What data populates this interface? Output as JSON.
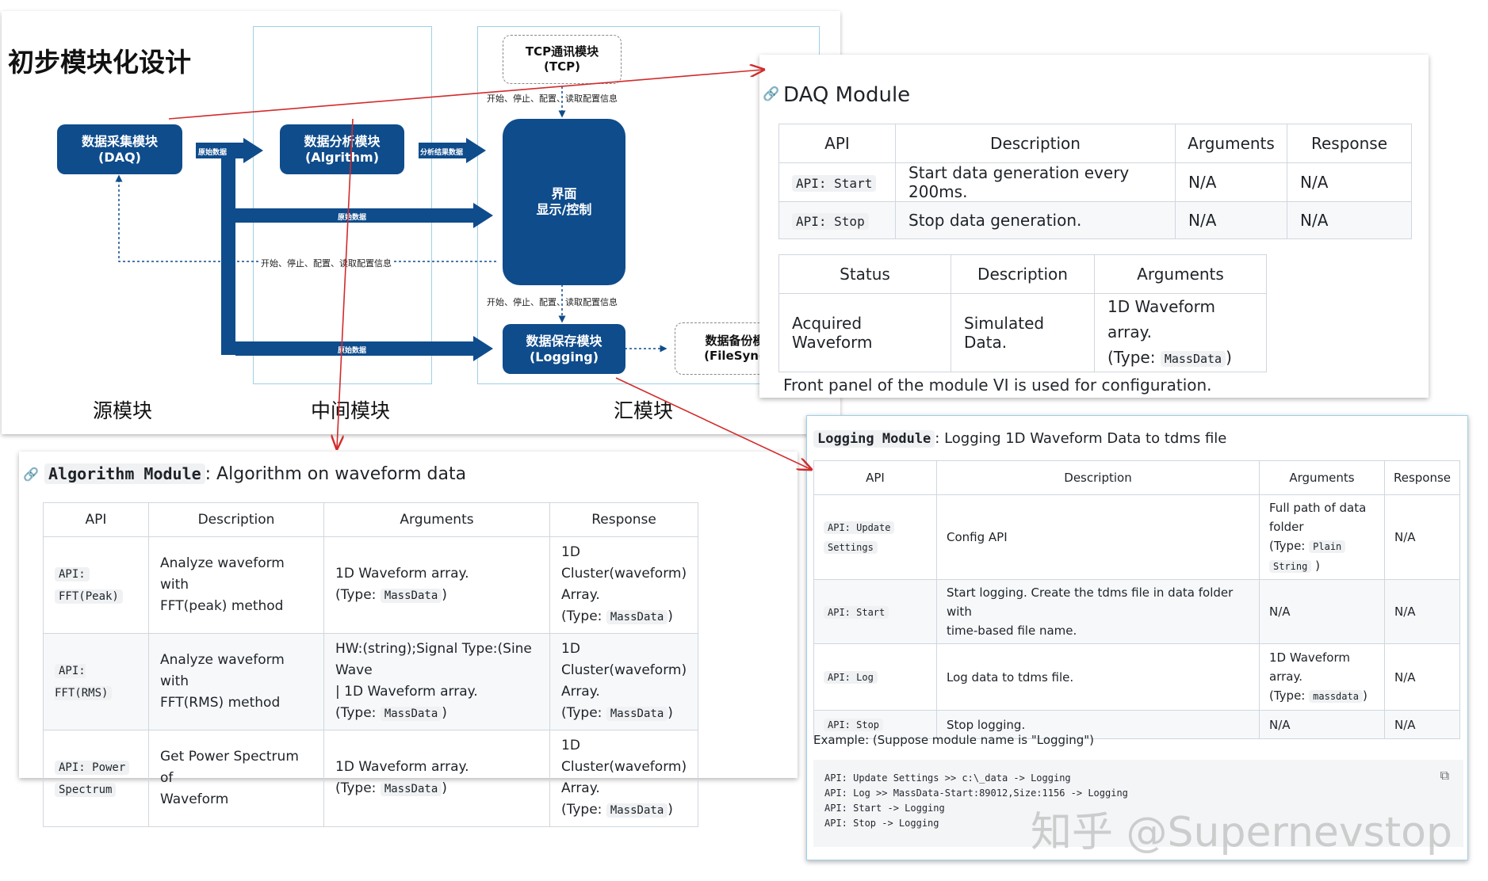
{
  "diagram": {
    "title": "初步模块化设计",
    "columns": {
      "source": "源模块",
      "middle": "中间模块",
      "sink": "汇模块"
    },
    "blocks": {
      "daq": [
        "数据采集模块",
        "(DAQ)"
      ],
      "algorithm": [
        "数据分析模块",
        "(Algrithm)"
      ],
      "ui": [
        "界面",
        "显示/控制"
      ],
      "logging": [
        "数据保存模块",
        "(Logging)"
      ],
      "tcp": [
        "TCP通讯模块",
        "(TCP)"
      ],
      "filesync": [
        "数据备份模",
        "(FileSync"
      ]
    },
    "labels": {
      "raw_data": "原始数据",
      "analysis_result": "分析结果数据",
      "control": "开始、停止、配置、读取配置信息"
    },
    "colors": {
      "block": "#0f4c8c",
      "link_arrow": "#d22b2b",
      "zone_border": "#9fd0e6"
    }
  },
  "daq_module": {
    "heading": "DAQ Module",
    "link_icon": "link-icon",
    "api_table": {
      "headers": [
        "API",
        "Description",
        "Arguments",
        "Response"
      ],
      "rows": [
        {
          "api": "API: Start",
          "description": "Start data generation every 200ms.",
          "arguments": "N/A",
          "response": "N/A"
        },
        {
          "api": "API: Stop",
          "description": "Stop data generation.",
          "arguments": "N/A",
          "response": "N/A"
        }
      ]
    },
    "status_table": {
      "headers": [
        "Status",
        "Description",
        "Arguments"
      ],
      "row": {
        "status": "Acquired Waveform",
        "description": "Simulated Data.",
        "arguments_line1": "1D Waveform array.",
        "arguments_type_prefix": "(Type:",
        "arguments_type": "MassData",
        "arguments_type_suffix": ")"
      }
    },
    "footer": "Front panel of the module VI is used for configuration."
  },
  "algorithm_module": {
    "heading_code": "Algorithm Module",
    "heading_text": ": Algorithm on waveform data",
    "headers": [
      "API",
      "Description",
      "Arguments",
      "Response"
    ],
    "rows": [
      {
        "api": [
          "API:",
          "FFT(Peak)"
        ],
        "description": [
          "Analyze waveform with",
          "FFT(peak) method"
        ],
        "arguments": [
          "1D Waveform array.",
          "(Type:",
          "MassData",
          ")"
        ],
        "response": [
          "1D Cluster(waveform)",
          "Array.",
          "(Type:",
          "MassData",
          ")"
        ]
      },
      {
        "api": [
          "API: FFT(RMS)"
        ],
        "description": [
          "Analyze waveform with",
          "FFT(RMS) method"
        ],
        "arguments": [
          "HW:(string);Signal Type:(Sine Wave",
          "| 1D Waveform array.",
          "(Type:",
          "MassData",
          ")"
        ],
        "response": [
          "1D Cluster(waveform)",
          "Array.",
          "(Type:",
          "MassData",
          ")"
        ]
      },
      {
        "api": [
          "API: Power",
          "Spectrum"
        ],
        "description": [
          "Get Power Spectrum of",
          "Waveform"
        ],
        "arguments": [
          "1D Waveform array.",
          "(Type:",
          "MassData",
          ")"
        ],
        "response": [
          "1D Cluster(waveform)",
          "Array.",
          "(Type:",
          "MassData",
          ")"
        ]
      }
    ]
  },
  "logging_module": {
    "heading_code": "Logging Module",
    "heading_text": ": Logging 1D Waveform Data to tdms file",
    "headers": [
      "API",
      "Description",
      "Arguments",
      "Response"
    ],
    "rows": [
      {
        "api": [
          "API: Update",
          "Settings"
        ],
        "description": [
          "Config API"
        ],
        "arguments": [
          "Full path of data",
          "folder",
          "(Type:",
          "Plain",
          "String",
          ")"
        ],
        "response": "N/A"
      },
      {
        "api": [
          "API: Start"
        ],
        "description": [
          "Start logging. Create the tdms file in data folder with",
          "time-based file name."
        ],
        "arguments": [
          "N/A"
        ],
        "response": "N/A"
      },
      {
        "api": [
          "API: Log"
        ],
        "description": [
          "Log data to tdms file."
        ],
        "arguments": [
          "1D Waveform",
          "array.",
          "(Type:",
          "massdata",
          ")"
        ],
        "response": "N/A"
      },
      {
        "api": [
          "API: Stop"
        ],
        "description": [
          "Stop logging."
        ],
        "arguments": [
          "N/A"
        ],
        "response": "N/A"
      }
    ],
    "example_label": "Example: (Suppose module name is \"Logging\")",
    "code_lines": [
      "API: Update Settings >> c:\\_data -> Logging",
      "API: Log >> MassData-Start:89012,Size:1156 -> Logging",
      "API: Start -> Logging",
      "API: Stop -> Logging"
    ],
    "copy_icon": "copy-icon"
  },
  "watermark": "知乎 @Supernevstop"
}
